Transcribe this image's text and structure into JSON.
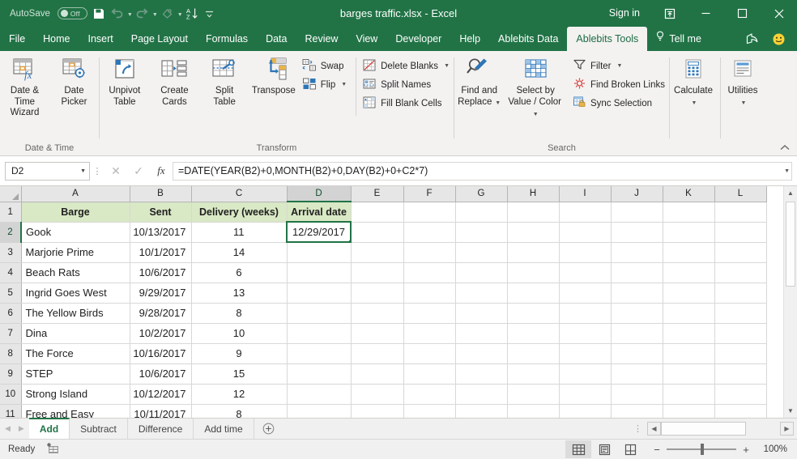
{
  "titlebar": {
    "autosave_label": "AutoSave",
    "autosave_state": "Off",
    "document_title": "barges traffic.xlsx  -  Excel",
    "signin_label": "Sign in",
    "qat": [
      {
        "name": "save-icon",
        "label": "Save"
      },
      {
        "name": "undo-icon",
        "label": "Undo"
      },
      {
        "name": "redo-icon",
        "label": "Redo"
      },
      {
        "name": "touch-mode-icon",
        "label": "Touch/Mouse Mode"
      },
      {
        "name": "sort-az-icon",
        "label": "Sort A to Z"
      },
      {
        "name": "customize-qat-icon",
        "label": "Customize Quick Access Toolbar"
      }
    ],
    "window_buttons": {
      "ribbon_display": "⊼",
      "minimize": "—",
      "maximize": "▢",
      "close": "✕"
    }
  },
  "ribbon_tabs": {
    "items": [
      {
        "label": "File",
        "active": false
      },
      {
        "label": "Home",
        "active": false
      },
      {
        "label": "Insert",
        "active": false
      },
      {
        "label": "Page Layout",
        "active": false
      },
      {
        "label": "Formulas",
        "active": false
      },
      {
        "label": "Data",
        "active": false
      },
      {
        "label": "Review",
        "active": false
      },
      {
        "label": "View",
        "active": false
      },
      {
        "label": "Developer",
        "active": false
      },
      {
        "label": "Help",
        "active": false
      },
      {
        "label": "Ablebits Data",
        "active": false
      },
      {
        "label": "Ablebits Tools",
        "active": true
      }
    ],
    "tell_me": "Tell me",
    "share_icon": "share-icon",
    "feedback_icon": "smiley-face-icon"
  },
  "ribbon": {
    "groups": [
      {
        "label": "Date & Time",
        "big_buttons": [
          {
            "line1": "Date &",
            "line2": "Time Wizard",
            "icon": "date-time-wizard-icon"
          },
          {
            "line1": "Date",
            "line2": "Picker",
            "icon": "date-picker-icon"
          }
        ]
      },
      {
        "label": "Transform",
        "big_buttons": [
          {
            "line1": "Unpivot",
            "line2": "Table",
            "icon": "unpivot-table-icon"
          },
          {
            "line1": "Create",
            "line2": "Cards",
            "icon": "create-cards-icon"
          },
          {
            "line1": "Split",
            "line2": "Table",
            "icon": "split-table-icon"
          },
          {
            "line1": "Transpose",
            "line2": "",
            "icon": "transpose-icon"
          }
        ],
        "small_col_1": [
          {
            "label": "Swap",
            "icon": "swap-icon",
            "caret": false
          },
          {
            "label": "Flip",
            "icon": "flip-icon",
            "caret": true
          }
        ],
        "small_col_2": [
          {
            "label": "Delete Blanks",
            "icon": "delete-blanks-icon",
            "caret": true
          },
          {
            "label": "Split Names",
            "icon": "split-names-icon",
            "caret": false
          },
          {
            "label": "Fill Blank Cells",
            "icon": "fill-blank-cells-icon",
            "caret": false
          }
        ]
      },
      {
        "label": "Search",
        "big_buttons": [
          {
            "line1": "Find and",
            "line2": "Replace",
            "icon": "find-replace-icon",
            "caret": true
          },
          {
            "line1": "Select by",
            "line2": "Value / Color",
            "icon": "select-by-value-color-icon",
            "caret": true
          }
        ],
        "small_col_1": [
          {
            "label": "Filter",
            "icon": "filter-icon",
            "caret": true
          },
          {
            "label": "Find Broken Links",
            "icon": "find-broken-links-icon",
            "caret": false
          },
          {
            "label": "Sync Selection",
            "icon": "sync-selection-icon",
            "caret": false
          }
        ]
      },
      {
        "label": "",
        "big_buttons": [
          {
            "line1": "Calculate",
            "line2": "",
            "icon": "calculate-icon",
            "caret": true
          },
          {
            "line1": "Utilities",
            "line2": "",
            "icon": "utilities-icon",
            "caret": true
          }
        ]
      }
    ],
    "collapse_icon": "chevron-up-icon"
  },
  "formula_bar": {
    "name_box_value": "D2",
    "cancel_icon": "✕",
    "enter_icon": "✓",
    "fx_icon": "fx",
    "formula": "=DATE(YEAR(B2)+0,MONTH(B2)+0,DAY(B2)+0+C2*7)"
  },
  "grid": {
    "columns": [
      "A",
      "B",
      "C",
      "D",
      "E",
      "F",
      "G",
      "H",
      "I",
      "J",
      "K",
      "L"
    ],
    "selected_column": "D",
    "selected_row": "2",
    "selected_cell": "D2",
    "rows": [
      {
        "num": "1",
        "cells": [
          "Barge",
          "Sent",
          "Delivery  (weeks)",
          "Arrival date",
          "",
          "",
          "",
          "",
          "",
          "",
          "",
          ""
        ]
      },
      {
        "num": "2",
        "cells": [
          "Gook",
          "10/13/2017",
          "11",
          "12/29/2017",
          "",
          "",
          "",
          "",
          "",
          "",
          "",
          ""
        ]
      },
      {
        "num": "3",
        "cells": [
          "Marjorie Prime",
          "10/1/2017",
          "14",
          "",
          "",
          "",
          "",
          "",
          "",
          "",
          "",
          ""
        ]
      },
      {
        "num": "4",
        "cells": [
          "Beach Rats",
          "10/6/2017",
          "6",
          "",
          "",
          "",
          "",
          "",
          "",
          "",
          "",
          ""
        ]
      },
      {
        "num": "5",
        "cells": [
          "Ingrid Goes West",
          "9/29/2017",
          "13",
          "",
          "",
          "",
          "",
          "",
          "",
          "",
          "",
          ""
        ]
      },
      {
        "num": "6",
        "cells": [
          "The Yellow Birds",
          "9/28/2017",
          "8",
          "",
          "",
          "",
          "",
          "",
          "",
          "",
          "",
          ""
        ]
      },
      {
        "num": "7",
        "cells": [
          "Dina",
          "10/2/2017",
          "10",
          "",
          "",
          "",
          "",
          "",
          "",
          "",
          "",
          ""
        ]
      },
      {
        "num": "8",
        "cells": [
          "The Force",
          "10/16/2017",
          "9",
          "",
          "",
          "",
          "",
          "",
          "",
          "",
          "",
          ""
        ]
      },
      {
        "num": "9",
        "cells": [
          "STEP",
          "10/6/2017",
          "15",
          "",
          "",
          "",
          "",
          "",
          "",
          "",
          "",
          ""
        ]
      },
      {
        "num": "10",
        "cells": [
          "Strong Island",
          "10/12/2017",
          "12",
          "",
          "",
          "",
          "",
          "",
          "",
          "",
          "",
          ""
        ]
      },
      {
        "num": "11",
        "cells": [
          "Free and Easy",
          "10/11/2017",
          "8",
          "",
          "",
          "",
          "",
          "",
          "",
          "",
          "",
          ""
        ]
      }
    ]
  },
  "sheet_tabs": {
    "items": [
      {
        "label": "Add",
        "active": true
      },
      {
        "label": "Subtract",
        "active": false
      },
      {
        "label": "Difference",
        "active": false
      },
      {
        "label": "Add time",
        "active": false
      }
    ],
    "add_sheet_icon": "plus-circle-icon",
    "prev_icon": "◀",
    "next_icon": "▶"
  },
  "status_bar": {
    "mode": "Ready",
    "macro_icon": "record-macro-icon",
    "views": [
      {
        "name": "normal-view-icon",
        "active": true
      },
      {
        "name": "page-layout-view-icon",
        "active": false
      },
      {
        "name": "page-break-preview-icon",
        "active": false
      }
    ],
    "zoom_out": "−",
    "zoom_in": "+",
    "zoom_level": "100%"
  },
  "colors": {
    "excel_green": "#217346",
    "header_fill": "#d9e8c5",
    "ribbon_bg": "#f3f2f1",
    "accent_blue": "#2e75b6"
  }
}
